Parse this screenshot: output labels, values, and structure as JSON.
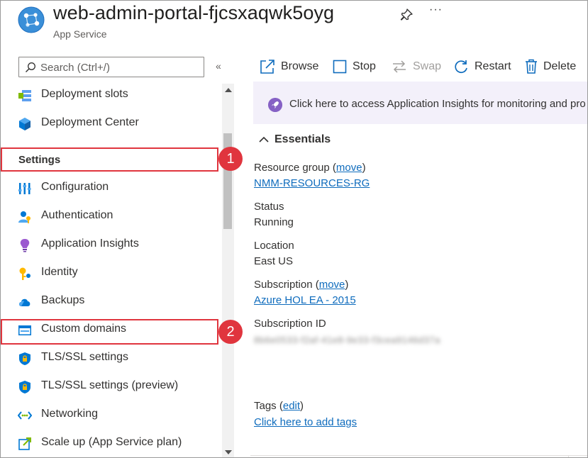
{
  "header": {
    "title": "web-admin-portal-fjcsxaqwk5oyg",
    "subtitle": "App Service",
    "more": "···"
  },
  "search": {
    "placeholder": "Search (Ctrl+/)",
    "collapse": "«"
  },
  "sidebar": {
    "items": [
      {
        "label": "Deployment slots",
        "icon": "deployment-slots-icon"
      },
      {
        "label": "Deployment Center",
        "icon": "deployment-center-icon"
      },
      {
        "label": "Configuration",
        "icon": "configuration-icon"
      },
      {
        "label": "Authentication",
        "icon": "authentication-icon"
      },
      {
        "label": "Application Insights",
        "icon": "application-insights-icon"
      },
      {
        "label": "Identity",
        "icon": "identity-icon"
      },
      {
        "label": "Backups",
        "icon": "backups-icon"
      },
      {
        "label": "Custom domains",
        "icon": "custom-domains-icon"
      },
      {
        "label": "TLS/SSL settings",
        "icon": "shield-icon"
      },
      {
        "label": "TLS/SSL settings (preview)",
        "icon": "shield-icon"
      },
      {
        "label": "Networking",
        "icon": "networking-icon"
      },
      {
        "label": "Scale up (App Service plan)",
        "icon": "scale-up-icon"
      }
    ],
    "section_settings": "Settings"
  },
  "callouts": {
    "one": "1",
    "two": "2"
  },
  "toolbar": {
    "browse": "Browse",
    "stop": "Stop",
    "swap": "Swap",
    "restart": "Restart",
    "delete": "Delete"
  },
  "banner": {
    "text": "Click here to access Application Insights for monitoring and pro"
  },
  "essentials": {
    "heading": "Essentials",
    "resource_group_label": "Resource group (",
    "move_link": "move",
    "close_paren": ")",
    "resource_group_value": "NMM-RESOURCES-RG",
    "status_label": "Status",
    "status_value": "Running",
    "location_label": "Location",
    "location_value": "East US",
    "subscription_label": "Subscription (",
    "subscription_value": "Azure HOL EA - 2015",
    "subscription_id_label": "Subscription ID",
    "subscription_id_value": "8b6e0533-f2af-41e8-9e33-f3cea9146d37a",
    "tags_label": "Tags (",
    "edit_link": "edit",
    "tags_value": "Click here to add tags"
  },
  "colors": {
    "accent": "#0f6cbd",
    "highlight": "#e0353e",
    "banner_bg": "#f3f0fa"
  }
}
